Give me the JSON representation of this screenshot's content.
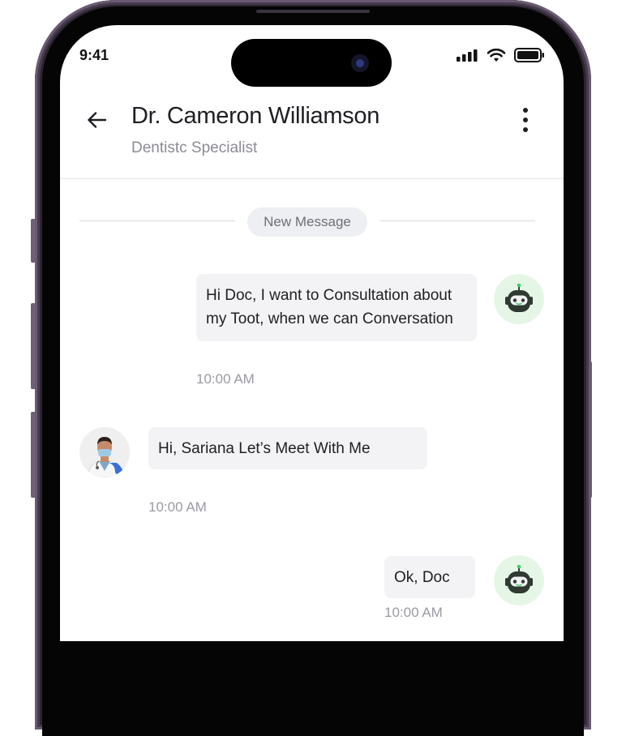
{
  "status_bar": {
    "time": "9:41",
    "icons": [
      "signal-icon",
      "wifi-icon",
      "battery-icon"
    ]
  },
  "header": {
    "title": "Dr. Cameron Williamson",
    "subtitle": "Dentistc Specialist",
    "back_icon": "arrow-left-icon",
    "menu_icon": "more-vertical-icon"
  },
  "separator": {
    "label": "New Message"
  },
  "messages": [
    {
      "sender": "user",
      "text": "Hi Doc, I want to Consultation about my Toot, when we can Conversation",
      "time": "10:00 AM",
      "avatar_icon": "robot-icon"
    },
    {
      "sender": "doctor",
      "text": "Hi, Sariana Let’s Meet With Me",
      "time": "10:00 AM",
      "avatar_icon": "doctor-avatar"
    },
    {
      "sender": "user",
      "text": "Ok, Doc",
      "time": "10:00 AM",
      "avatar_icon": "robot-icon"
    }
  ],
  "colors": {
    "bubble_bg": "#f3f3f5",
    "avatar_bg": "#e6f6e6",
    "robot_accent": "#3ecf6a",
    "frame": "#2c2530"
  }
}
